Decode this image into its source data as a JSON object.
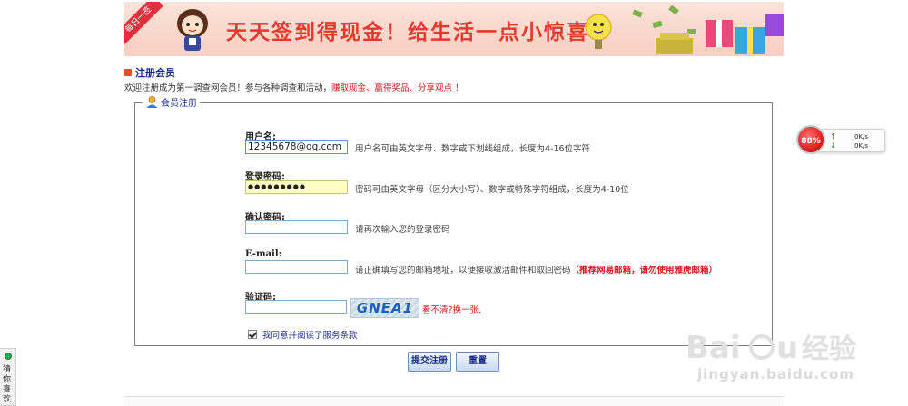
{
  "banner": {
    "ribbon": "每日一签",
    "slogan": "天天签到得现金！给生活一点小惊喜"
  },
  "section": {
    "title": "注册会员",
    "welcome_prefix": "欢迎注册成为第一调查网会员！参与各种调查和活动，",
    "welcome_highlight": "赚取现金、赢得奖品、分享观点 ！"
  },
  "form": {
    "legend": "会员注册",
    "username": {
      "label": "用户名:",
      "value": "12345678@qq.com",
      "hint": "用户名可由英文字母、数字或下划线组成，长度为4-16位字符"
    },
    "password": {
      "label": "登录密码:",
      "value": "●●●●●●●●●",
      "hint": "密码可由英文字母（区分大小写）、数字或特殊字符组成，长度为4-10位"
    },
    "confirm": {
      "label": "确认密码:",
      "value": "",
      "hint": "请再次输入您的登录密码"
    },
    "email": {
      "label": "E-mail:",
      "value": "",
      "hint": "请正确填写您的邮箱地址，以便接收激活邮件和取回密码",
      "hint_red": "（推荐网易邮箱，请勿使用雅虎邮箱）"
    },
    "captcha": {
      "label": "验证码:",
      "value": "",
      "image_text": "GNEA1",
      "refresh": "看不清?换一张."
    },
    "agree": {
      "checked": true,
      "label": "我同意并阅读了服务条款"
    },
    "submit_label": "提交注册",
    "reset_label": "重置"
  },
  "widget": {
    "percent": "88%",
    "upload": "0K/s",
    "download": "0K/s"
  },
  "side_tab": {
    "label": "猜你喜欢"
  },
  "watermark": {
    "url": "jingyan.baidu.com"
  },
  "colors": {
    "accent_red": "#d2161e",
    "link_blue": "#1a2a8a",
    "password_bg": "#ffffc4"
  }
}
